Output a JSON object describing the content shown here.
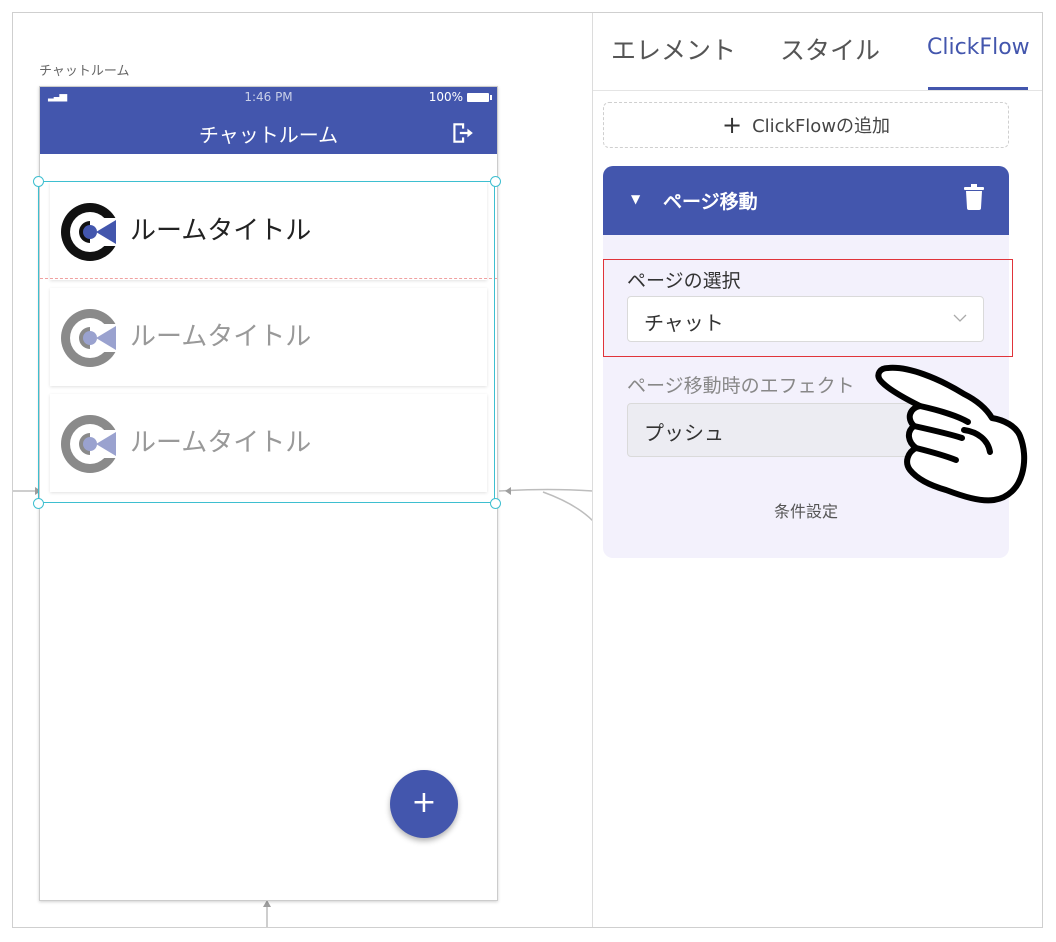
{
  "canvas": {
    "page_label": "チャットルーム",
    "status": {
      "time": "1:46 PM",
      "battery": "100%"
    },
    "appbar": {
      "title": "チャットルーム"
    },
    "rooms": [
      {
        "title": "ルームタイトル"
      },
      {
        "title": "ルームタイトル"
      },
      {
        "title": "ルームタイトル"
      }
    ],
    "fab_label": "+"
  },
  "panel": {
    "tabs": [
      {
        "label": "エレメント"
      },
      {
        "label": "スタイル"
      },
      {
        "label": "ClickFlow"
      }
    ],
    "add_button": {
      "label": "ClickFlowの追加"
    },
    "flow": {
      "title": "ページ移動",
      "page_select": {
        "label": "ページの選択",
        "value": "チャット"
      },
      "effect_select": {
        "label": "ページ移動時のエフェクト",
        "value": "プッシュ"
      },
      "condition_label": "条件設定"
    }
  },
  "colors": {
    "brand": "#4356ad",
    "selection": "#3ebfd0",
    "highlight": "#e0343a"
  }
}
